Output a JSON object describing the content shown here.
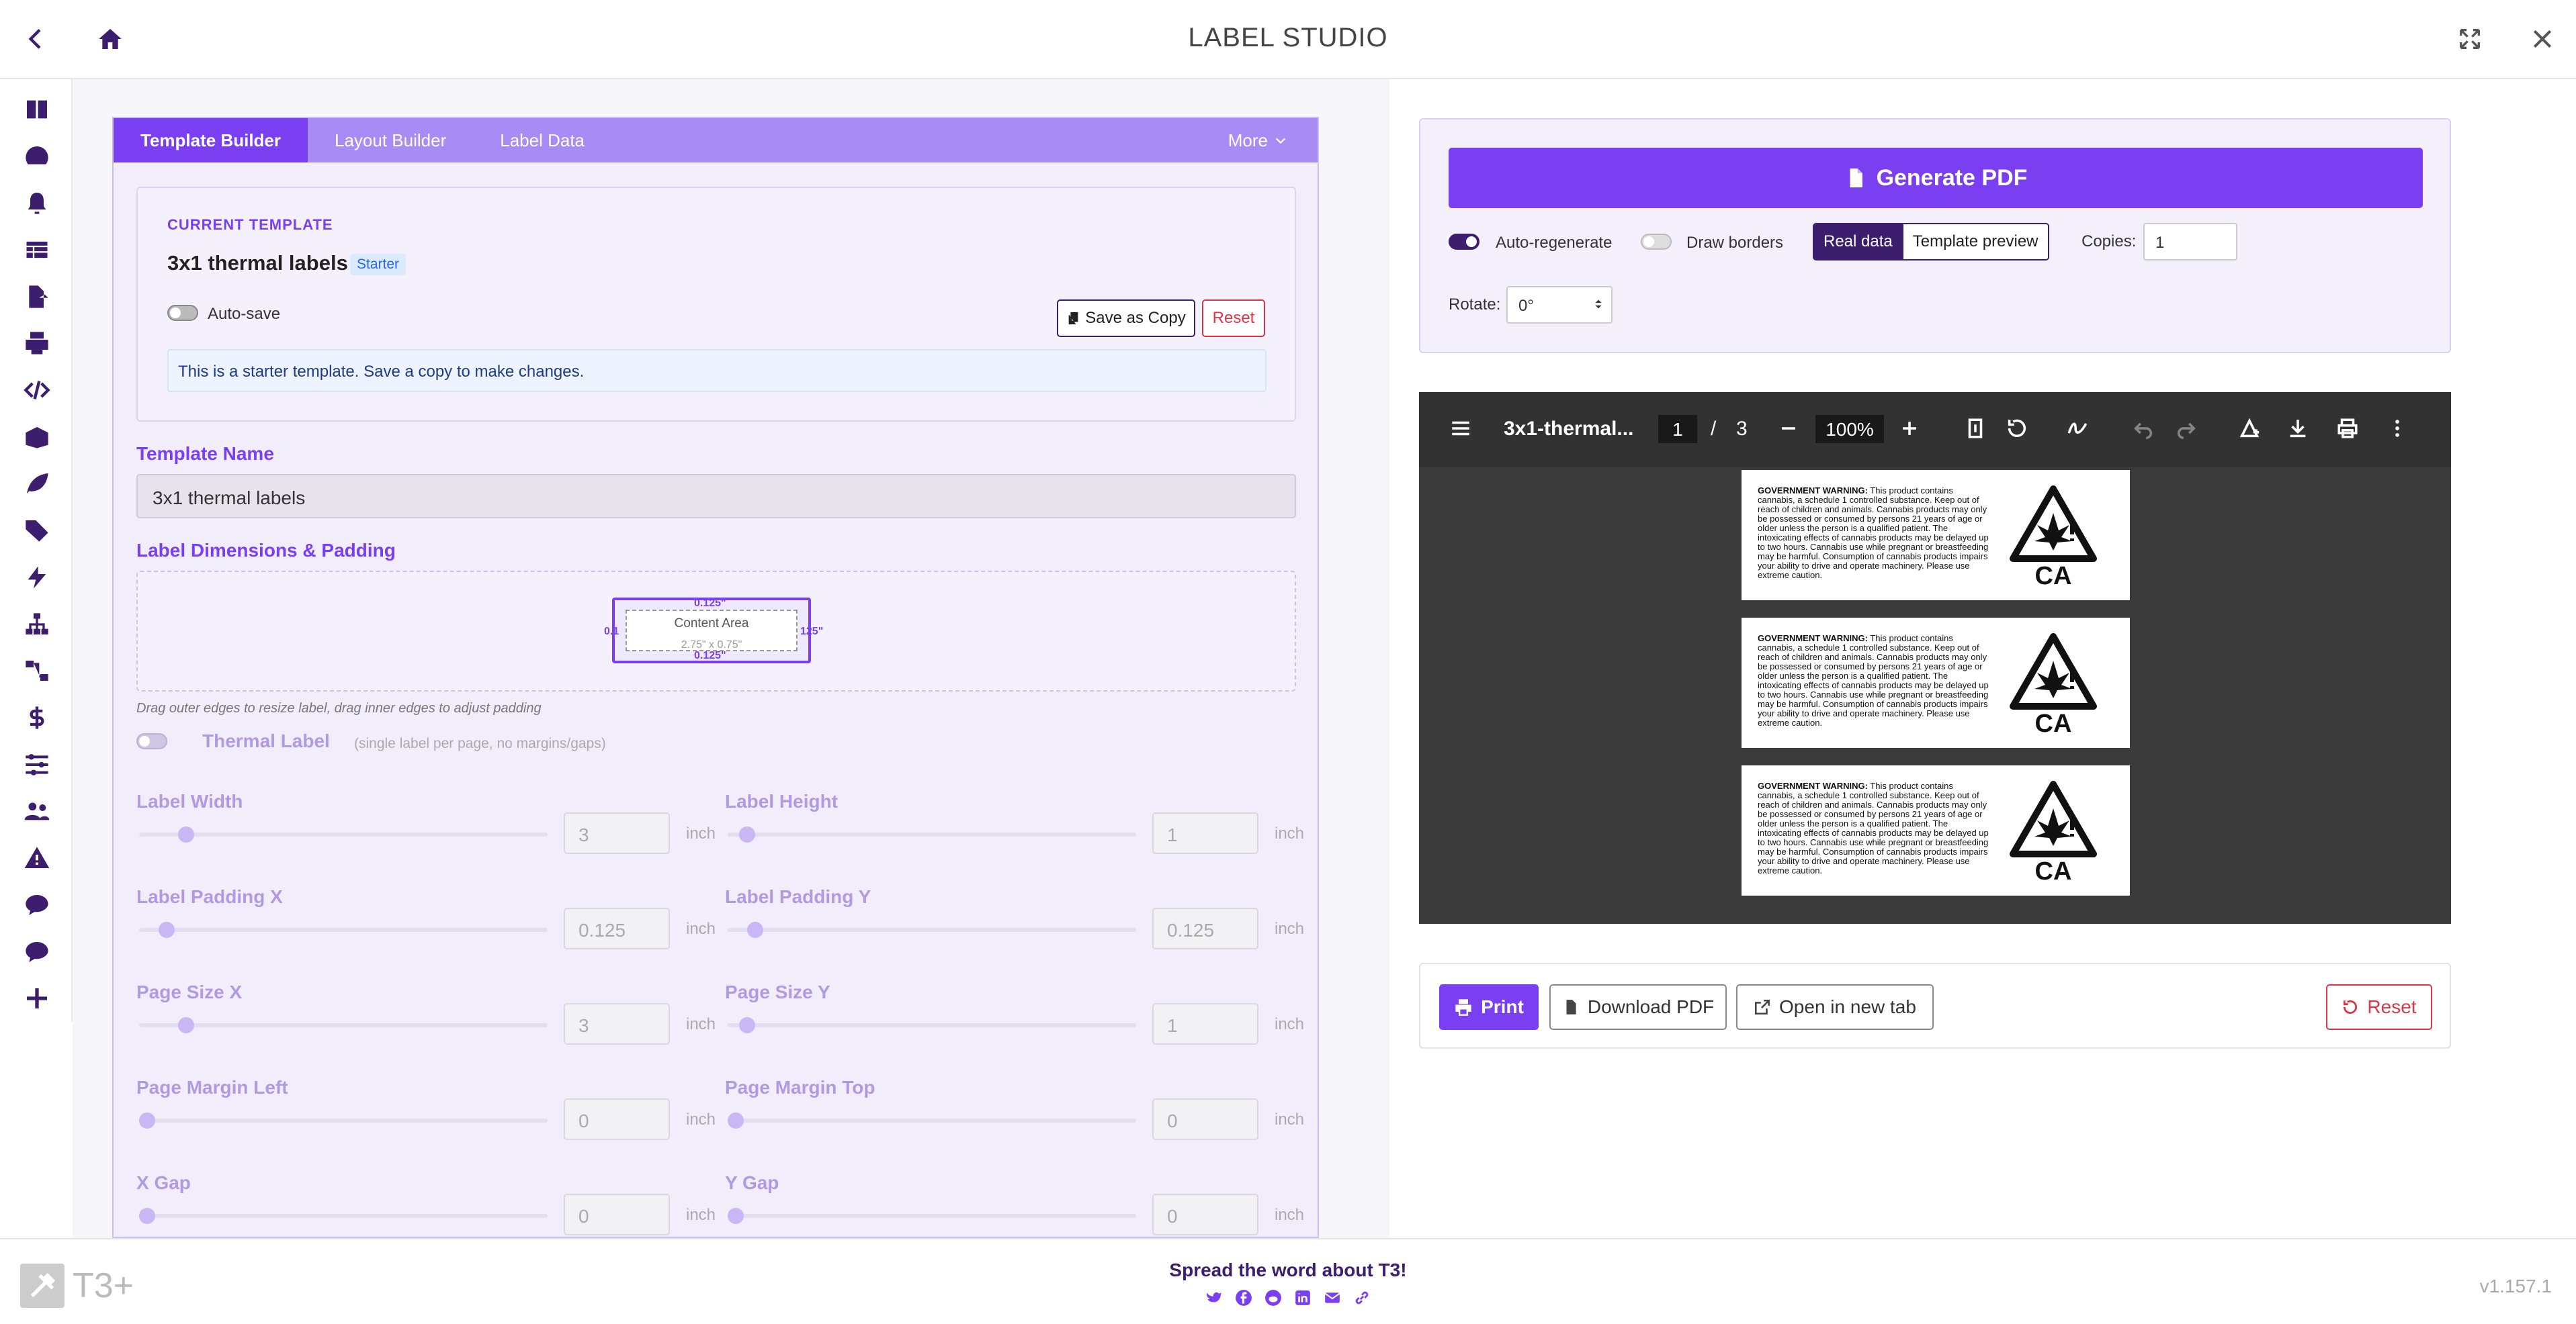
{
  "app": {
    "title": "LABEL STUDIO"
  },
  "sidebar": {
    "icons": [
      "book-icon",
      "dashboard-icon",
      "bell-icon",
      "table-icon",
      "file-export-icon",
      "printer-icon",
      "code-icon",
      "box-icon",
      "leaf-icon",
      "tags-icon",
      "bolt-icon",
      "sitemap-icon",
      "flow-icon",
      "dollar-icon",
      "sliders-icon",
      "users-icon",
      "warning-icon",
      "chat-icon",
      "chat-alt-icon",
      "plus-icon"
    ]
  },
  "tabs": {
    "template_builder": "Template Builder",
    "layout_builder": "Layout Builder",
    "label_data": "Label Data",
    "more": "More"
  },
  "current_template": {
    "heading": "CURRENT TEMPLATE",
    "name": "3x1 thermal labels",
    "badge": "Starter",
    "autosave_label": "Auto-save",
    "save_copy_label": "Save as Copy",
    "reset_label": "Reset",
    "info": "This is a starter template. Save a copy to make changes."
  },
  "template_name": {
    "label": "Template Name",
    "value": "3x1 thermal labels"
  },
  "dimensions": {
    "label": "Label Dimensions & Padding",
    "content_area": "Content Area",
    "content_size": "2.75\" x 0.75\"",
    "pad_top": "0.125\"",
    "pad_bottom": "0.125\"",
    "pad_left": "0.1",
    "pad_right": "125\"",
    "hint": "Drag outer edges to resize label, drag inner edges to adjust padding"
  },
  "thermal": {
    "label": "Thermal Label",
    "sub": "(single label per page, no margins/gaps)"
  },
  "fields": {
    "label_width": {
      "label": "Label Width",
      "value": "3",
      "unit": "inch",
      "level": 0.1
    },
    "label_height": {
      "label": "Label Height",
      "value": "1",
      "unit": "inch",
      "level": 0.03
    },
    "padding_x": {
      "label": "Label Padding X",
      "value": "0.125",
      "unit": "inch",
      "level": 0.05
    },
    "padding_y": {
      "label": "Label Padding Y",
      "value": "0.125",
      "unit": "inch",
      "level": 0.05
    },
    "page_x": {
      "label": "Page Size X",
      "value": "3",
      "unit": "inch",
      "level": 0.1
    },
    "page_y": {
      "label": "Page Size Y",
      "value": "1",
      "unit": "inch",
      "level": 0.03
    },
    "margin_left": {
      "label": "Page Margin Left",
      "value": "0",
      "unit": "inch",
      "level": 0
    },
    "margin_top": {
      "label": "Page Margin Top",
      "value": "0",
      "unit": "inch",
      "level": 0
    },
    "x_gap": {
      "label": "X Gap",
      "value": "0",
      "unit": "inch",
      "level": 0
    },
    "y_gap": {
      "label": "Y Gap",
      "value": "0",
      "unit": "inch",
      "level": 0
    }
  },
  "generate": {
    "button": "Generate PDF",
    "auto_regen": "Auto-regenerate",
    "draw_borders": "Draw borders",
    "real_data": "Real data",
    "template_preview": "Template preview",
    "copies_label": "Copies:",
    "copies_value": "1",
    "rotate_label": "Rotate:",
    "rotate_value": "0°"
  },
  "pdf": {
    "filename": "3x1-thermal...",
    "page": "1",
    "page_sep": "/",
    "total_pages": "3",
    "zoom": "100%",
    "warning_bold": "GOVERNMENT WARNING:",
    "warning_text": " This product contains cannabis, a schedule 1 controlled substance. Keep out of reach of children and animals. Cannabis products may only be possessed or consumed by persons 21 years of age or older unless the person is a qualified patient. The intoxicating effects of cannabis products may be delayed up to two hours. Cannabis use while pregnant or breastfeeding may be harmful. Consumption of cannabis products impairs your ability to drive and operate machinery. Please use extreme caution.",
    "badge_text": "CA"
  },
  "actions": {
    "print": "Print",
    "download": "Download PDF",
    "open": "Open in new tab",
    "reset": "Reset"
  },
  "footer": {
    "logo_text": "T3+",
    "spread": "Spread the word about T3!",
    "version": "v1.157.1"
  },
  "colors": {
    "accent": "#7a3ff0",
    "dark": "#3d1d6e",
    "danger": "#dc3545"
  }
}
